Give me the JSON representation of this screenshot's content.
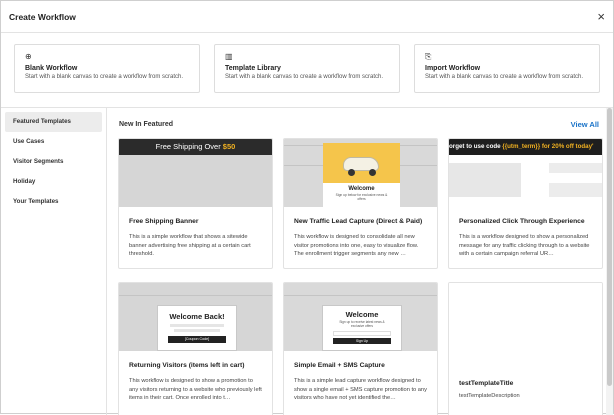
{
  "modal": {
    "title": "Create Workflow",
    "close_label": "×"
  },
  "options": [
    {
      "icon": "plus-circle-icon",
      "glyph": "⊕",
      "title": "Blank Workflow",
      "desc": "Start with a blank canvas to create a workflow from scratch."
    },
    {
      "icon": "library-icon",
      "glyph": "▥",
      "title": "Template Library",
      "desc": "Start with a blank canvas to create a workflow from scratch."
    },
    {
      "icon": "import-icon",
      "glyph": "⎘",
      "title": "Import Workflow",
      "desc": "Start with a blank canvas to create a workflow from scratch."
    }
  ],
  "sidebar": {
    "items": [
      {
        "label": "Featured Templates",
        "active": true
      },
      {
        "label": "Use Cases",
        "active": false
      },
      {
        "label": "Visitor Segments",
        "active": false
      },
      {
        "label": "Holiday",
        "active": false
      },
      {
        "label": "Your Templates",
        "active": false
      }
    ]
  },
  "content": {
    "section_title": "New In Featured",
    "view_all": "View All",
    "cards": [
      {
        "title": "Free Shipping Banner",
        "desc": "This is a simple workflow that shows a sitewide banner advertising free shipping at a certain cart threshold.",
        "thumb": {
          "banner_text": "Free Shipping Over ",
          "banner_value": "$50"
        }
      },
      {
        "title": "New Traffic Lead Capture (Direct & Paid)",
        "desc": "This workflow is designed to consolidate all new visitor promotions into one, easy to visualize flow. The enrollment trigger segments any new …",
        "thumb": {
          "popup_title": "Welcome",
          "popup_text": "Sign up below for exclusive news & offers"
        }
      },
      {
        "title": "Personalized Click Through Experience",
        "desc": "This is a workflow designed to show a personalized message for any traffic clicking through to a website with a certain campaign referral UR…",
        "thumb": {
          "pre": "orget to use code ",
          "code": "{{utm_term}}",
          "off": " for 20% off today'"
        }
      },
      {
        "title": "Returning Visitors (items left in cart)",
        "desc": "This workflow is designed to show a promotion to any visitors returning to a website who previously left items in their cart. Once enrolled into t…",
        "thumb": {
          "popup_title": "Welcome Back!",
          "button": "[Coupon Code]"
        }
      },
      {
        "title": "Simple Email + SMS Capture",
        "desc": "This is a simple lead capture workflow designed to show a single email + SMS capture promotion to any visitors who have not yet identified the…",
        "thumb": {
          "popup_title": "Welcome",
          "popup_text": "Sign up to receive latest news & exclusive offers",
          "button": "Sign Up"
        }
      },
      {
        "title": "testTemplateTitle",
        "desc": "testTemplateDescription",
        "thumb": {}
      }
    ]
  },
  "colors": {
    "accent": "#1a73c8",
    "highlight": "#f2b221",
    "banner_dark": "#2b2b2b"
  }
}
